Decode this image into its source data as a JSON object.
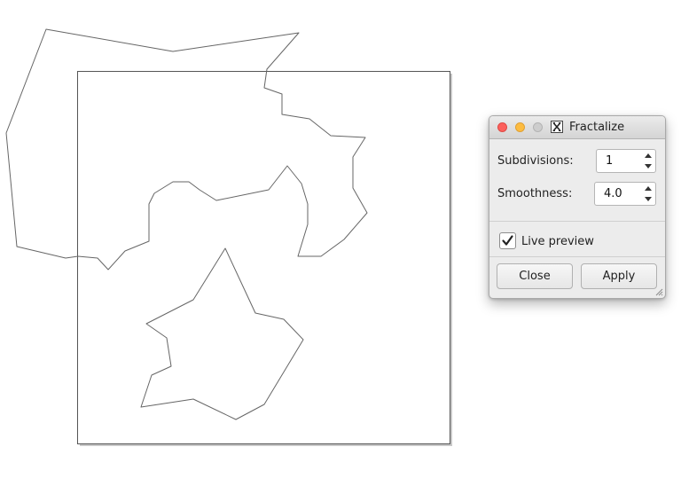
{
  "canvas": {
    "background": "#ffffff",
    "stroke_color": "#555555"
  },
  "dialog": {
    "title": "Fractalize",
    "title_icon": "x-window-icon",
    "controls": [
      "close-window-icon",
      "minimize-window-icon",
      "zoom-window-icon"
    ],
    "fields": {
      "subdivisions": {
        "label": "Subdivisions:",
        "value": "1"
      },
      "smoothness": {
        "label": "Smoothness:",
        "value": "4.0"
      }
    },
    "live_preview": {
      "label": "Live preview",
      "checked": true
    },
    "buttons": {
      "close": "Close",
      "apply": "Apply"
    },
    "colors": {
      "close_light": "#fc605c",
      "minimize_light": "#fdbc40",
      "zoom_light": "#cdcdcd",
      "dialog_bg": "#ececec"
    }
  }
}
